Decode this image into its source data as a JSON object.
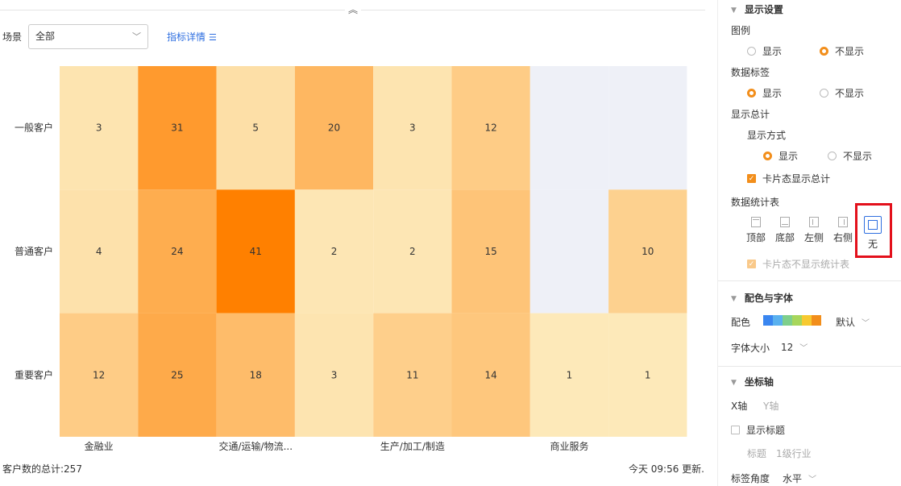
{
  "top": {
    "collapse_icon": "double-chevron-up-icon"
  },
  "filter": {
    "scene_label": "场景",
    "scene_value": "全部",
    "detail_link": "指标详情"
  },
  "chart_data": {
    "type": "heatmap",
    "rows": [
      "一般客户",
      "普通客户",
      "重要客户"
    ],
    "columns": [
      "金融业",
      "",
      "交通/运输/物流...",
      "",
      "生产/加工/制造",
      "",
      "商业服务",
      ""
    ],
    "values": [
      [
        3,
        31,
        5,
        20,
        3,
        12,
        null,
        null
      ],
      [
        4,
        24,
        41,
        2,
        2,
        15,
        null,
        10
      ],
      [
        12,
        25,
        18,
        3,
        11,
        14,
        1,
        1
      ]
    ],
    "color_min": "#fde9b9",
    "color_max": "#ff8000",
    "empty_color": "#eef0f7"
  },
  "footer": {
    "total": "客户数的总计:257",
    "updated": "今天 09:56 更新."
  },
  "panel": {
    "display": {
      "title": "显示设置",
      "legend_label": "图例",
      "legend_show": "显示",
      "legend_hide": "不显示",
      "data_label": "数据标签",
      "data_show": "显示",
      "data_hide": "不显示",
      "total_label": "显示总计",
      "mode_label": "显示方式",
      "mode_show": "显示",
      "mode_hide": "不显示",
      "card_total": "卡片态显示总计",
      "table_label": "数据统计表",
      "table_options": [
        "顶部",
        "底部",
        "左侧",
        "右侧",
        "无"
      ],
      "card_no_table": "卡片态不显示统计表"
    },
    "color_font": {
      "title": "配色与字体",
      "color_label": "配色",
      "palette": [
        "#3a86f0",
        "#5ab1ef",
        "#7ecf8c",
        "#a7d65b",
        "#f7c930",
        "#f28e1b"
      ],
      "palette_name": "默认",
      "font_label": "字体大小",
      "font_value": "12"
    },
    "axis": {
      "title": "坐标轴",
      "x_tab": "X轴",
      "y_tab": "Y轴",
      "show_title": "显示标题",
      "title_label": "标题",
      "title_value": "1级行业",
      "angle_label": "标签角度",
      "angle_value": "水平"
    }
  }
}
